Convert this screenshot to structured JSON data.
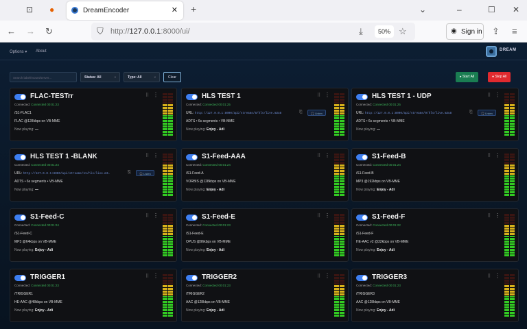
{
  "browser": {
    "tab_title": "DreamEncoder",
    "url_prefix": "http://",
    "url_host": "127.0.0.1",
    "url_rest": ":8000/ui/",
    "zoom": "50%",
    "sign_in": "Sign in"
  },
  "nav": {
    "options": "Options ▾",
    "about": "About",
    "logo_text": "DREAM"
  },
  "filters": {
    "search_placeholder": "Search label/mount/server...",
    "status": "Status: All",
    "type": "Type: All",
    "clear": "Clear",
    "start_all": "▸ Start All",
    "stop_all": "● Stop All"
  },
  "colors": {
    "accent": "#3d7ef0",
    "start": "#1a7d52",
    "stop": "#e02a2f",
    "connected": "#3cb55a"
  },
  "labels": {
    "connected": "Connected:",
    "url": "URL:",
    "now_playing": "Now playing:",
    "listen": "🎧 Listen"
  },
  "cards": [
    {
      "title": "FLAC-TESTrr",
      "status": "Connected 00:01:23",
      "mount": "/S1-FLAC1",
      "format": "FLAC @128kbps on VB-MME",
      "now_playing": "—",
      "enabled": true,
      "level": 0.72
    },
    {
      "title": "HLS TEST 1",
      "status": "Connected 00:01:25",
      "url": "http://127.0.0.1:8000/api/streams/8/hls/live.m3u8",
      "format": "ADTS • 6s segments • VB-MME",
      "now_playing": "Enjoy - Adi",
      "enabled": true,
      "level": 0.72
    },
    {
      "title": "HLS TEST 1 - UDP",
      "status": "Connected 00:01:25",
      "url": "http://127.0.0.1:8000/api/streams/9/hls/live.m3u8",
      "format": "ADTS • 6s segments • VB-MME",
      "now_playing": "—",
      "enabled": true,
      "level": 0.72
    },
    {
      "title": "HLS TEST 1 -BLANK",
      "status": "Connected 00:01:24",
      "url": "http://127.0.0.1:8000/api/streams/11/hls/live.m3…",
      "format": "ADTS • 6s segments • VB-MME",
      "now_playing": "—",
      "enabled": true,
      "level": 0.72
    },
    {
      "title": "S1-Feed-AAA",
      "status": "Connected 00:01:24",
      "mount": "/S1-Feed-A",
      "format": "VORBIS @128kbps on VB-MME",
      "now_playing": "Enjoy - Adi",
      "enabled": true,
      "level": 0.72
    },
    {
      "title": "S1-Feed-B",
      "status": "Connected 00:01:24",
      "mount": "/S1-Feed-B",
      "format": "MP3 @192kbps on VB-MME",
      "now_playing": "Enjoy - Adi",
      "enabled": true,
      "level": 0.72
    },
    {
      "title": "S1-Feed-C",
      "status": "Connected 00:01:24",
      "mount": "/S1-Feed-C",
      "format": "MP3 @64kbps on VB-MME",
      "now_playing": "Enjoy - Adi",
      "enabled": true,
      "level": 0.72
    },
    {
      "title": "S1-Feed-E",
      "status": "Connected 00:01:23",
      "mount": "/S1-Feed-E",
      "format": "OPUS @96kbps on VB-MME",
      "now_playing": "Enjoy - Adi",
      "enabled": true,
      "level": 0.72
    },
    {
      "title": "S1-Feed-F",
      "status": "Connected 00:01:22",
      "mount": "/S1-Feed-F",
      "format": "HE-AAC v2 @32kbps on VB-MME",
      "now_playing": "Enjoy - Adi",
      "enabled": true,
      "level": 0.72
    },
    {
      "title": "TRIGGER1",
      "status": "Connected 00:01:23",
      "mount": "/TRIGGER1",
      "format": "HE-AAC @48kbps on VB-MME",
      "now_playing": "Enjoy - Adi",
      "enabled": true,
      "level": 0.72
    },
    {
      "title": "TRIGGER2",
      "status": "Connected 00:01:23",
      "mount": "/TRIGGER2",
      "format": "AAC @128kbps on VB-MME",
      "now_playing": "Enjoy - Adi",
      "enabled": true,
      "level": 0.72
    },
    {
      "title": "TRIGGER3",
      "status": "Connected 00:01:23",
      "mount": "/TRIGGER3",
      "format": "AAC @128kbps on VB-MME",
      "now_playing": "Enjoy - Adi",
      "enabled": true,
      "level": 0.72
    }
  ]
}
